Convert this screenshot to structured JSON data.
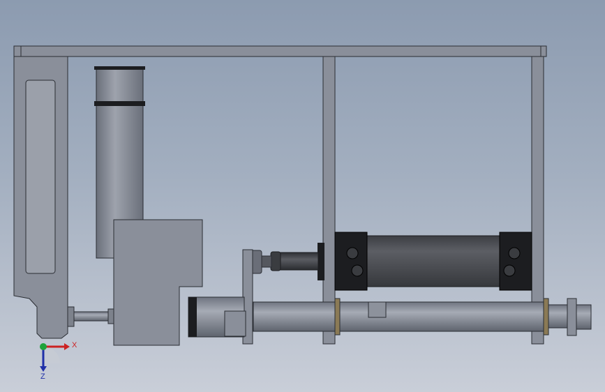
{
  "viewport": {
    "background_top": "#8c9bb0",
    "background_bottom": "#c9ced8"
  },
  "part_colors": {
    "frame": "#8a8f9a",
    "frame_dark": "#5d626c",
    "outline": "#2a2d33",
    "cylinder_body": "#4e5056",
    "cylinder_cap": "#1c1d20",
    "tube": "#8d929c",
    "seal_ring": "#8b7a55"
  },
  "triad": {
    "x_label": "X",
    "z_label": "Z",
    "x_color": "#cc2222",
    "z_color": "#1f2fa8",
    "origin_color": "#1fa33a"
  }
}
